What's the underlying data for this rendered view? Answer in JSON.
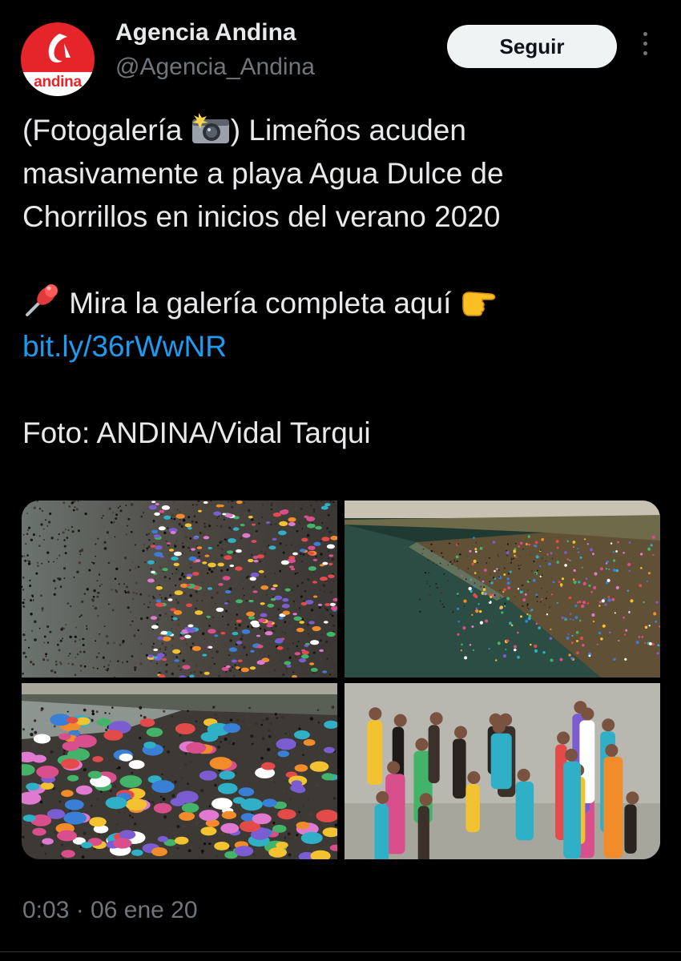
{
  "account": {
    "display_name": "Agencia Andina",
    "handle": "@Agencia_Andina",
    "avatar_text": "andina",
    "avatar_color": "#e6252a"
  },
  "follow_button": {
    "label": "Seguir"
  },
  "tweet": {
    "line1_prefix": "(Fotogalería ",
    "line1_suffix": ") Limeños acuden",
    "line2": "masivamente a playa Agua Dulce de",
    "line3": "Chorrillos en inicios del verano 2020",
    "line4": " Mira la galería completa aquí ",
    "link": "bit.ly/36rWwNR",
    "credit": "Foto: ANDINA/Vidal Tarqui"
  },
  "media": [
    {
      "icon": "beach-crowd-photo"
    },
    {
      "icon": "coastline-beach-photo"
    },
    {
      "icon": "umbrellas-beach-photo"
    },
    {
      "icon": "people-in-water-photo"
    }
  ],
  "timestamp": "0:03 · 06 ene 20",
  "colors": {
    "background": "#000000",
    "text": "#e7e9ea",
    "secondary": "#71767b",
    "link": "#1d9bf0",
    "button_bg": "#eff3f4"
  }
}
